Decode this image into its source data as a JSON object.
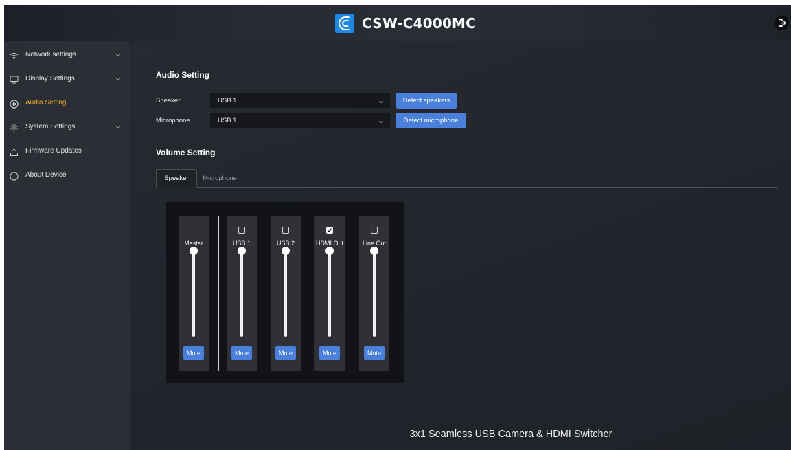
{
  "app": {
    "brand_name": "CSW-C4000MC",
    "brand_color": "#1e88e5",
    "active_color": "#f4b223",
    "button_color": "#4a7fdc"
  },
  "sidebar": {
    "items": [
      {
        "label": "Network settings",
        "icon": "wifi-icon",
        "has_chevron": true
      },
      {
        "label": "Display Settings",
        "icon": "monitor-icon",
        "has_chevron": true
      },
      {
        "label": "Audio Setting",
        "icon": "audio-icon",
        "active": true
      },
      {
        "label": "System Settings",
        "icon": "gear-icon",
        "has_chevron": true
      },
      {
        "label": "Firmware Updates",
        "icon": "upload-icon"
      },
      {
        "label": "About Device",
        "icon": "info-icon"
      }
    ]
  },
  "audio_setting": {
    "title": "Audio Setting",
    "speaker": {
      "label": "Speaker",
      "value": "USB 1",
      "button": "Detect speakers"
    },
    "microphone": {
      "label": "Microphone",
      "value": "USB 1",
      "button": "Detect microphone"
    }
  },
  "volume_setting": {
    "title": "Volume Setting",
    "tabs": [
      {
        "label": "Speaker",
        "active": true
      },
      {
        "label": "Microphone",
        "active": false
      }
    ],
    "channels": [
      {
        "name": "Master",
        "checkbox": null,
        "level": 1.0,
        "mute_label": "Mute"
      },
      {
        "name": "USB 1",
        "checkbox": false,
        "level": 1.0,
        "mute_label": "Mute"
      },
      {
        "name": "USB 2",
        "checkbox": false,
        "level": 1.0,
        "mute_label": "Mute"
      },
      {
        "name": "HDMI Out",
        "checkbox": true,
        "level": 1.0,
        "mute_label": "Mute"
      },
      {
        "name": "Line Out",
        "checkbox": false,
        "level": 1.0,
        "mute_label": "Mute"
      }
    ]
  },
  "footer": {
    "text": "3x1 Seamless USB Camera & HDMI Switcher"
  }
}
